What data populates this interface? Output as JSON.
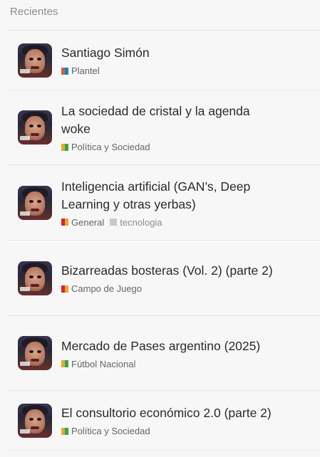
{
  "section": {
    "title": "Recientes"
  },
  "topics": [
    {
      "title": "Santiago Simón",
      "category": "Plantel",
      "colors": [
        "#e45735",
        "#0088cc"
      ],
      "tags": []
    },
    {
      "title": "La sociedad de cristal y la agenda woke",
      "category": "Política y Sociedad",
      "colors": [
        "#f1a32f",
        "#2ea84a"
      ],
      "tags": []
    },
    {
      "title": "Inteligencia artificial (GAN’s, Deep Learning y otras yerbas)",
      "category": "General",
      "colors": [
        "#d9252a",
        "#f1a32f"
      ],
      "tags": [
        "tecnologia"
      ]
    },
    {
      "title": "Bizarreadas bosteras (Vol. 2) (parte 2)",
      "category": "Campo de Juego",
      "colors": [
        "#d9252a",
        "#f1a32f"
      ],
      "tags": []
    },
    {
      "title": "Mercado de Pases argentino (2025)",
      "category": "Fútbol Nacional",
      "colors": [
        "#f1a32f",
        "#2ea84a"
      ],
      "tags": []
    },
    {
      "title": "El consultorio económico 2.0 (parte 2)",
      "category": "Política y Sociedad",
      "colors": [
        "#f1a32f",
        "#2ea84a"
      ],
      "tags": []
    }
  ]
}
